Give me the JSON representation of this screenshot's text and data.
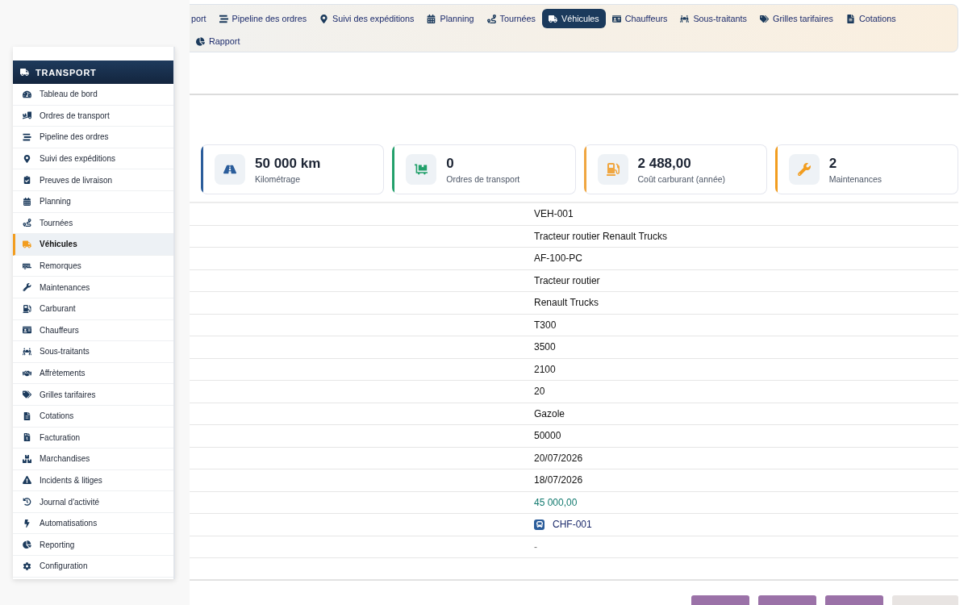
{
  "nav_tabs": [
    {
      "label": "port",
      "selected": false
    },
    {
      "label": "Pipeline des ordres",
      "selected": false
    },
    {
      "label": "Suivi des expéditions",
      "selected": false
    },
    {
      "label": "Planning",
      "selected": false
    },
    {
      "label": "Tournées",
      "selected": false
    },
    {
      "label": "Véhicules",
      "selected": true
    },
    {
      "label": "Chauffeurs",
      "selected": false
    },
    {
      "label": "Sous-traitants",
      "selected": false
    },
    {
      "label": "Grilles tarifaires",
      "selected": false
    },
    {
      "label": "Cotations",
      "selected": false
    },
    {
      "label": "Rapport",
      "selected": false
    }
  ],
  "stats": [
    {
      "value": "50 000 km",
      "label": "Kilométrage",
      "color": "#2b5d9b"
    },
    {
      "value": "0",
      "label": "Ordres de transport",
      "color": "#22a06b"
    },
    {
      "value": "2 488,00",
      "label": "Coût carburant (année)",
      "color": "#f0a640"
    },
    {
      "value": "2",
      "label": "Maintenances",
      "color": "#f29d1f"
    }
  ],
  "details": [
    {
      "kind": "text",
      "value": "VEH-001"
    },
    {
      "kind": "text",
      "value": "Tracteur routier Renault Trucks"
    },
    {
      "kind": "text",
      "value": "AF-100-PC"
    },
    {
      "kind": "text",
      "value": "Tracteur routier"
    },
    {
      "kind": "text",
      "value": "Renault Trucks"
    },
    {
      "kind": "text",
      "value": "T300"
    },
    {
      "kind": "text",
      "value": "3500"
    },
    {
      "kind": "text",
      "value": "2100"
    },
    {
      "kind": "text",
      "value": "20"
    },
    {
      "kind": "text",
      "value": "Gazole"
    },
    {
      "kind": "text",
      "value": "50000"
    },
    {
      "kind": "text",
      "value": "20/07/2026"
    },
    {
      "kind": "text",
      "value": "18/07/2026"
    },
    {
      "kind": "money",
      "value": "45 000,00"
    },
    {
      "kind": "link",
      "value": "CHF-001"
    },
    {
      "kind": "empty",
      "value": "-"
    }
  ],
  "footer_buttons": [
    {
      "kind": "primary"
    },
    {
      "kind": "primary"
    },
    {
      "kind": "primary"
    },
    {
      "kind": "secondary"
    }
  ],
  "menu": {
    "title": "TRANSPORT",
    "items": [
      {
        "label": "Tableau de bord",
        "selected": false
      },
      {
        "label": "Ordres de transport",
        "selected": false
      },
      {
        "label": "Pipeline des ordres",
        "selected": false
      },
      {
        "label": "Suivi des expéditions",
        "selected": false
      },
      {
        "label": "Preuves de livraison",
        "selected": false
      },
      {
        "label": "Planning",
        "selected": false
      },
      {
        "label": "Tournées",
        "selected": false
      },
      {
        "label": "Véhicules",
        "selected": true
      },
      {
        "label": "Remorques",
        "selected": false
      },
      {
        "label": "Maintenances",
        "selected": false
      },
      {
        "label": "Carburant",
        "selected": false
      },
      {
        "label": "Chauffeurs",
        "selected": false
      },
      {
        "label": "Sous-traitants",
        "selected": false
      },
      {
        "label": "Affrètements",
        "selected": false
      },
      {
        "label": "Grilles tarifaires",
        "selected": false
      },
      {
        "label": "Cotations",
        "selected": false
      },
      {
        "label": "Facturation",
        "selected": false
      },
      {
        "label": "Marchandises",
        "selected": false
      },
      {
        "label": "Incidents & litiges",
        "selected": false
      },
      {
        "label": "Journal d'activité",
        "selected": false
      },
      {
        "label": "Automatisations",
        "selected": false
      },
      {
        "label": "Reporting",
        "selected": false
      },
      {
        "label": "Configuration",
        "selected": false
      }
    ]
  }
}
